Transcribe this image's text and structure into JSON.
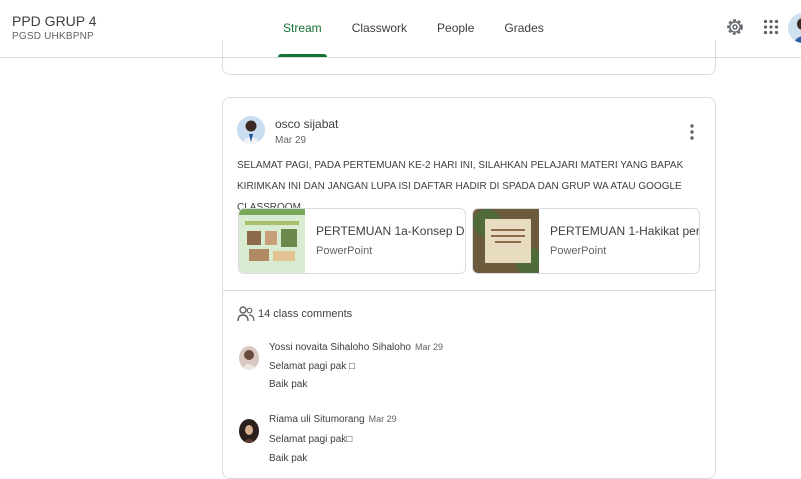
{
  "header": {
    "class_name": "PPD GRUP 4",
    "class_section": "PGSD UHKBPNP",
    "tabs": [
      {
        "label": "Stream",
        "active": true
      },
      {
        "label": "Classwork",
        "active": false
      },
      {
        "label": "People",
        "active": false
      },
      {
        "label": "Grades",
        "active": false
      }
    ],
    "icons": [
      "settings-icon",
      "apps-grid-icon",
      "account-avatar"
    ]
  },
  "post": {
    "author": "osco sijabat",
    "date": "Mar 29",
    "body": "SELAMAT PAGI, PADA PERTEMUAN KE-2 HARI INI, SILAHKAN PELAJARI MATERI YANG BAPAK KIRIMKAN INI DAN JANGAN LUPA ISI DAFTAR HADIR DI SPADA DAN GRUP WA ATAU GOOGLE CLASSROOM.",
    "attachments": [
      {
        "title": "PERTEMUAN 1a-Konsep D...",
        "type": "PowerPoint"
      },
      {
        "title": "PERTEMUAN 1-Hakikat per...",
        "type": "PowerPoint"
      }
    ]
  },
  "comments": {
    "count_label": "14 class comments",
    "items": [
      {
        "name": "Yossi novaita Sihaloho Sihaloho",
        "date": "Mar 29",
        "lines": [
          "Selamat pagi pak □",
          "Baik pak"
        ]
      },
      {
        "name": "Riama uli Situmorang",
        "date": "Mar 29",
        "lines": [
          "Selamat pagi pak□",
          "Baik pak"
        ]
      }
    ]
  },
  "colors": {
    "accent": "#137333",
    "border": "#dadce0",
    "text": "#3c4043",
    "muted": "#5f6368"
  }
}
